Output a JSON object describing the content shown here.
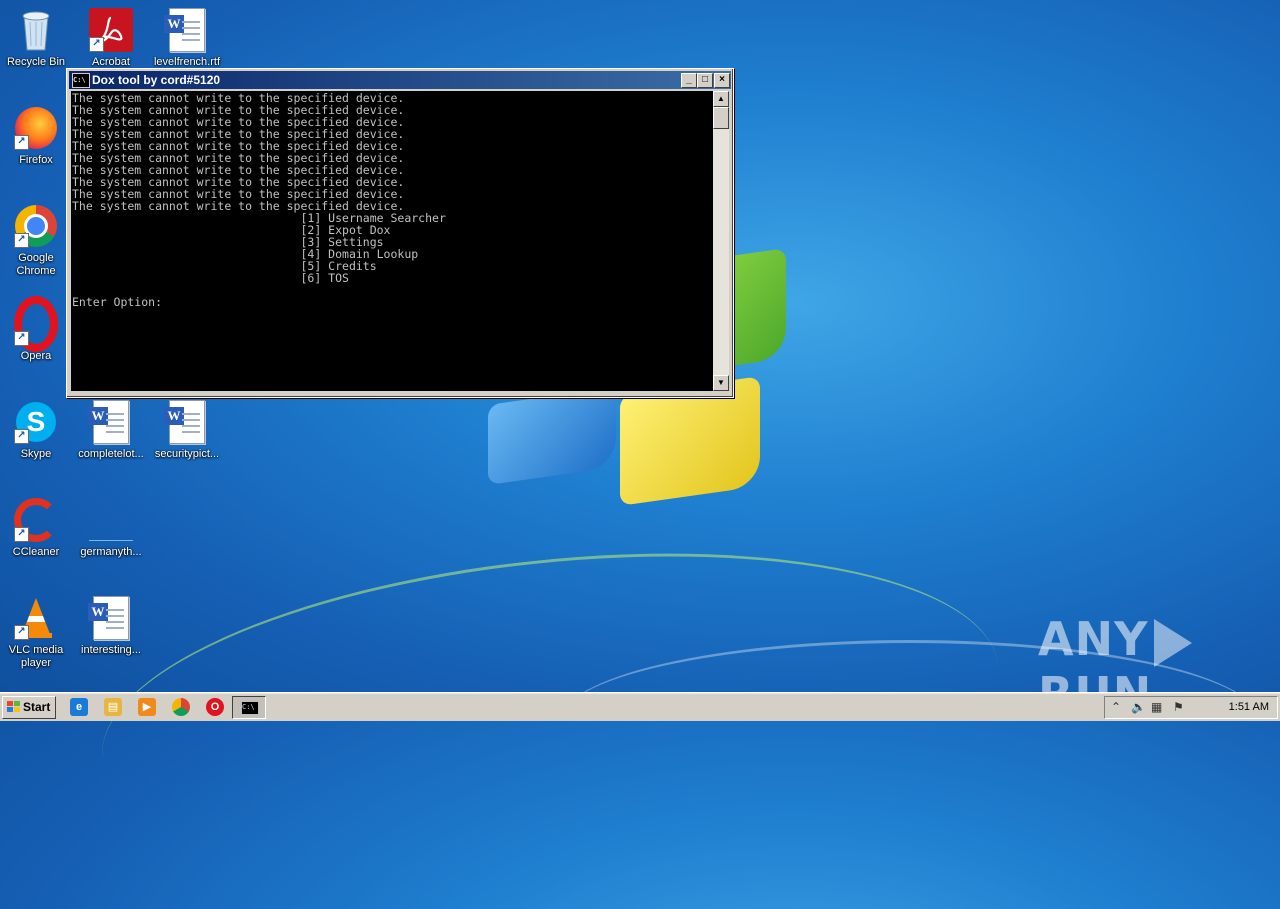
{
  "desktop": {
    "icons": [
      {
        "label": "Recycle Bin",
        "icon": "recycle-bin-icon"
      },
      {
        "label": "Acrobat",
        "icon": "acrobat-icon"
      },
      {
        "label": "levelfrench.rtf",
        "icon": "word-document-icon"
      },
      {
        "label": "Firefox",
        "icon": "firefox-icon"
      },
      {
        "label": "Google Chrome",
        "icon": "chrome-icon"
      },
      {
        "label": "Opera",
        "icon": "opera-icon"
      },
      {
        "label": "Skype",
        "icon": "skype-icon"
      },
      {
        "label": "completelot...",
        "icon": "word-document-icon"
      },
      {
        "label": "securitypict...",
        "icon": "word-document-icon"
      },
      {
        "label": "CCleaner",
        "icon": "ccleaner-icon"
      },
      {
        "label": "germanyth...",
        "icon": "blank-file-icon"
      },
      {
        "label": "VLC media player",
        "icon": "vlc-icon"
      },
      {
        "label": "interesting...",
        "icon": "word-document-icon"
      }
    ]
  },
  "window": {
    "title": "Dox tool by cord#5120",
    "controls": {
      "minimize": "_",
      "maximize": "□",
      "close": "×"
    },
    "console_text": "The system cannot write to the specified device.\nThe system cannot write to the specified device.\nThe system cannot write to the specified device.\nThe system cannot write to the specified device.\nThe system cannot write to the specified device.\nThe system cannot write to the specified device.\nThe system cannot write to the specified device.\nThe system cannot write to the specified device.\nThe system cannot write to the specified device.\nThe system cannot write to the specified device.\n                                 [1] Username Searcher\n                                 [2] Expot Dox\n                                 [3] Settings\n                                 [4] Domain Lookup\n                                 [5] Credits\n                                 [6] TOS\n\nEnter Option:"
  },
  "taskbar": {
    "start_label": "Start",
    "quick_launch": [
      "internet-explorer-icon",
      "explorer-icon",
      "media-player-icon",
      "chrome-icon",
      "opera-icon"
    ],
    "active_task": "cmd-icon",
    "clock": "1:51 AM"
  },
  "watermark": {
    "left": "ANY",
    "right": "RUN"
  }
}
